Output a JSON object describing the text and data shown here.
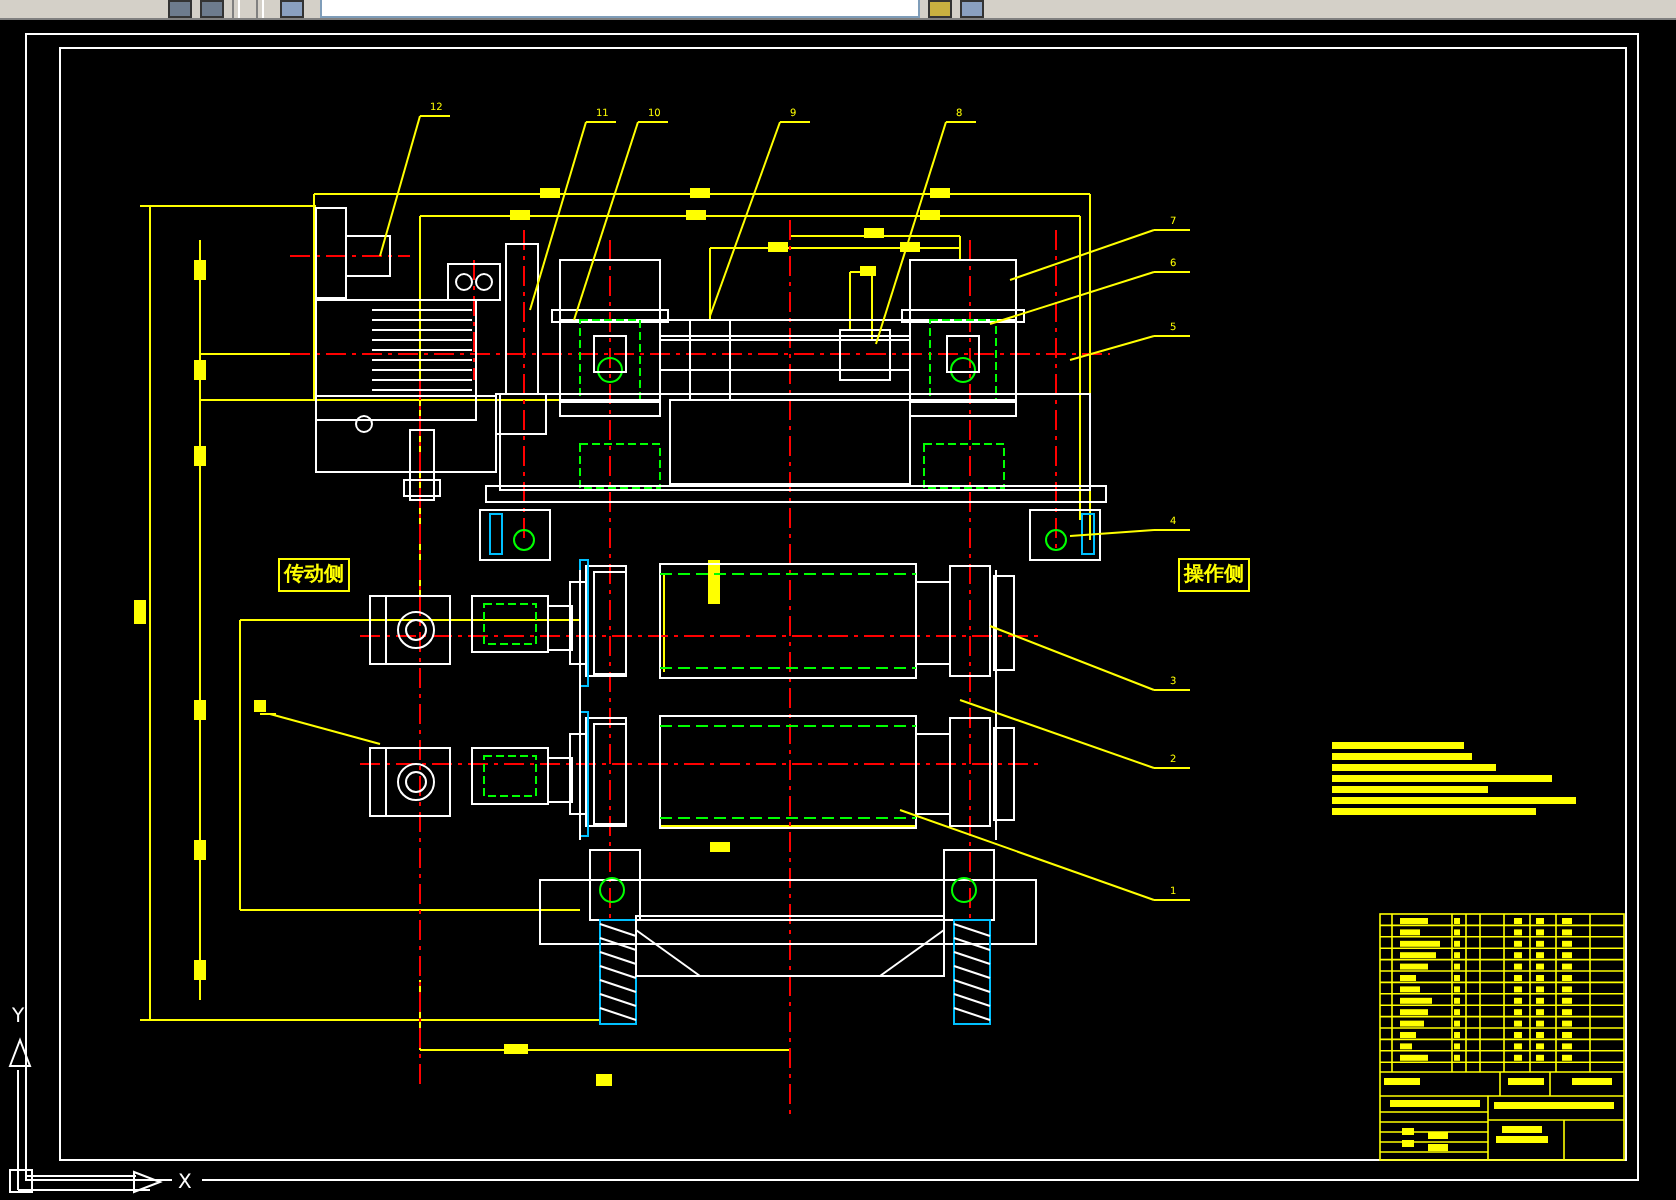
{
  "drawing": {
    "side_labels": [
      "传动侧",
      "操作侧"
    ],
    "balloons": [
      "12",
      "11",
      "10",
      "9",
      "8",
      "7",
      "6",
      "5",
      "4",
      "3",
      "2",
      "1"
    ]
  },
  "ucs": {
    "y_label": "Y",
    "x_label": "X"
  }
}
